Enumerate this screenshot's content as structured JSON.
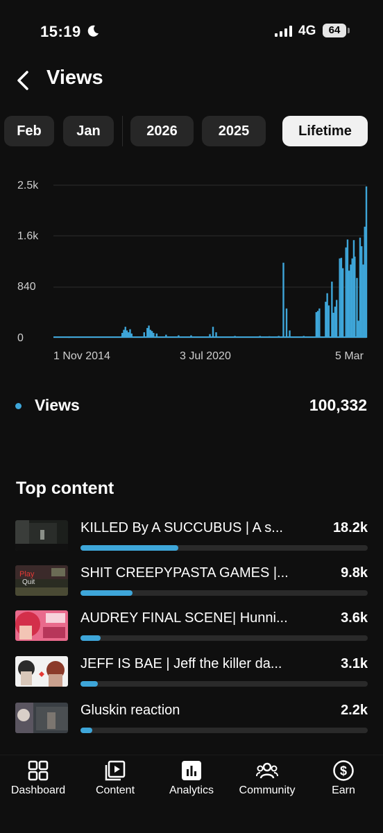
{
  "status": {
    "time": "15:19",
    "network": "4G",
    "battery": "64"
  },
  "header": {
    "title": "Views"
  },
  "tabs": [
    {
      "label": "Feb",
      "active": false
    },
    {
      "label": "Jan",
      "active": false
    },
    {
      "label": "2026",
      "active": false
    },
    {
      "label": "2025",
      "active": false
    },
    {
      "label": "Lifetime",
      "active": true
    }
  ],
  "chart_data": {
    "type": "line",
    "y_ticks": [
      "2.5k",
      "1.6k",
      "840",
      "0"
    ],
    "x_ticks": [
      "1 Nov 2014",
      "3 Jul 2020",
      "5 Mar"
    ],
    "ylim": [
      0,
      2500
    ],
    "series": [
      {
        "color": "#3ea6d9",
        "spikes": [
          [
            0.05,
            10
          ],
          [
            0.1,
            15
          ],
          [
            0.15,
            12
          ],
          [
            0.2,
            20
          ],
          [
            0.22,
            80
          ],
          [
            0.225,
            130
          ],
          [
            0.23,
            180
          ],
          [
            0.235,
            120
          ],
          [
            0.24,
            90
          ],
          [
            0.245,
            140
          ],
          [
            0.25,
            70
          ],
          [
            0.29,
            90
          ],
          [
            0.3,
            160
          ],
          [
            0.305,
            200
          ],
          [
            0.31,
            130
          ],
          [
            0.315,
            110
          ],
          [
            0.32,
            80
          ],
          [
            0.33,
            70
          ],
          [
            0.36,
            50
          ],
          [
            0.4,
            40
          ],
          [
            0.44,
            40
          ],
          [
            0.5,
            60
          ],
          [
            0.51,
            180
          ],
          [
            0.52,
            90
          ],
          [
            0.58,
            30
          ],
          [
            0.62,
            20
          ],
          [
            0.66,
            30
          ],
          [
            0.69,
            25
          ],
          [
            0.72,
            30
          ],
          [
            0.735,
            1230
          ],
          [
            0.745,
            480
          ],
          [
            0.755,
            120
          ],
          [
            0.78,
            20
          ],
          [
            0.8,
            30
          ],
          [
            0.84,
            420
          ],
          [
            0.845,
            440
          ],
          [
            0.85,
            480
          ],
          [
            0.87,
            590
          ],
          [
            0.875,
            730
          ],
          [
            0.88,
            530
          ],
          [
            0.89,
            920
          ],
          [
            0.895,
            410
          ],
          [
            0.9,
            510
          ],
          [
            0.905,
            620
          ],
          [
            0.915,
            1300
          ],
          [
            0.92,
            1310
          ],
          [
            0.925,
            1140
          ],
          [
            0.935,
            1480
          ],
          [
            0.94,
            1610
          ],
          [
            0.945,
            1100
          ],
          [
            0.95,
            1200
          ],
          [
            0.955,
            1300
          ],
          [
            0.96,
            1600
          ],
          [
            0.963,
            1330
          ],
          [
            0.97,
            980
          ],
          [
            0.975,
            280
          ],
          [
            0.98,
            1640
          ],
          [
            0.985,
            1500
          ],
          [
            0.99,
            1200
          ],
          [
            0.995,
            1820
          ],
          [
            1.0,
            2480
          ]
        ]
      }
    ]
  },
  "legend": {
    "label": "Views",
    "value": "100,332"
  },
  "top_content": {
    "title": "Top content",
    "items": [
      {
        "title": "KILLED By A SUCCUBUS | A s...",
        "value": "18.2k",
        "fraction": 0.34
      },
      {
        "title": "SHIT CREEPYPASTA GAMES |...",
        "value": "9.8k",
        "fraction": 0.18
      },
      {
        "title": "AUDREY FINAL SCENE| Hunni...",
        "value": "3.6k",
        "fraction": 0.07
      },
      {
        "title": "JEFF IS BAE | Jeff the killer da...",
        "value": "3.1k",
        "fraction": 0.06
      },
      {
        "title": "Gluskin reaction",
        "value": "2.2k",
        "fraction": 0.04
      }
    ]
  },
  "nav": [
    {
      "label": "Dashboard",
      "icon": "dashboard-icon"
    },
    {
      "label": "Content",
      "icon": "content-icon"
    },
    {
      "label": "Analytics",
      "icon": "analytics-icon"
    },
    {
      "label": "Community",
      "icon": "community-icon"
    },
    {
      "label": "Earn",
      "icon": "earn-icon"
    }
  ]
}
